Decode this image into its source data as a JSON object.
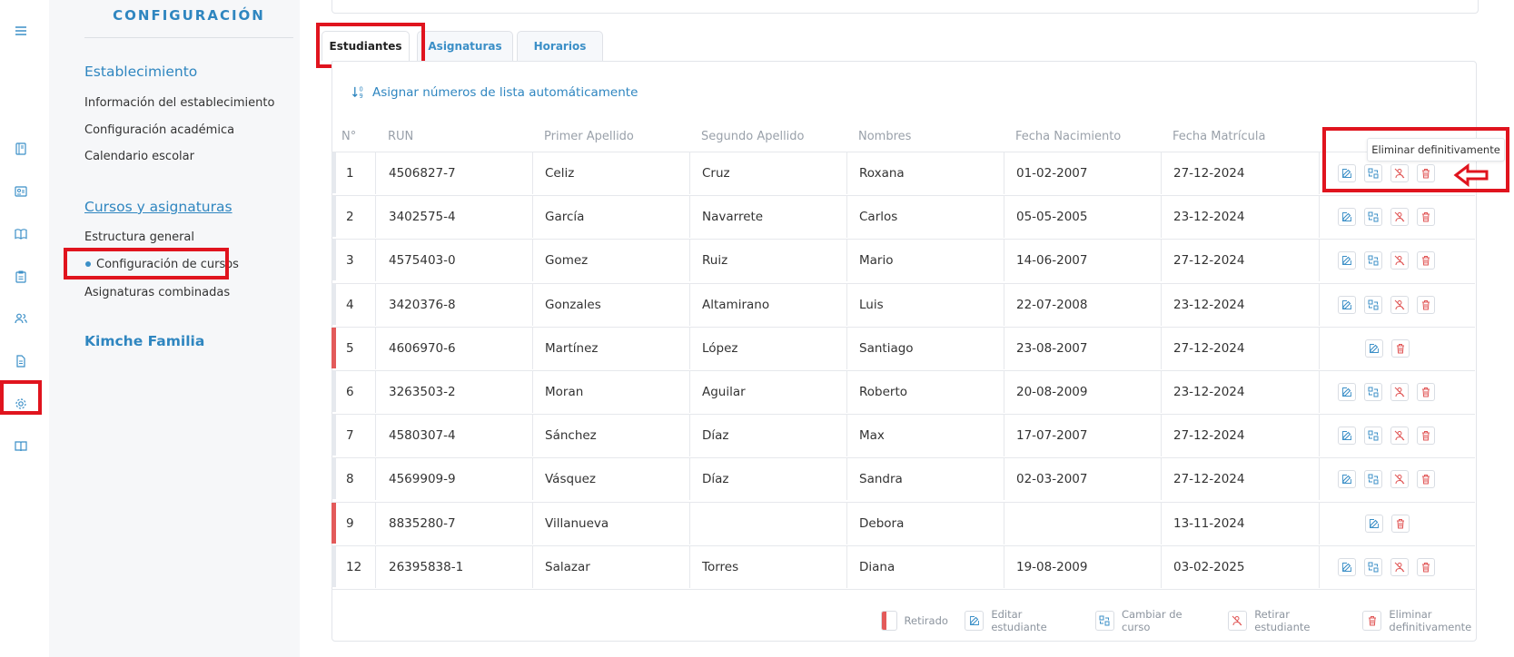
{
  "rail": {
    "icons": [
      "menu-icon",
      "book-icon",
      "id-card-icon",
      "open-book-icon",
      "clipboard-icon",
      "users-icon",
      "document-icon",
      "gear-icon",
      "book-open-icon"
    ]
  },
  "settings": {
    "title": "CONFIGURACIÓN",
    "sections": [
      {
        "heading": "Establecimiento",
        "items": [
          "Información del establecimiento",
          "Configuración académica",
          "Calendario escolar"
        ]
      },
      {
        "heading": "Cursos y asignaturas",
        "items": [
          "Estructura general",
          "Configuración de cursos",
          "Asignaturas combinadas"
        ]
      },
      {
        "heading": "Kimche Familia",
        "items": []
      }
    ]
  },
  "tabs": [
    "Estudiantes",
    "Asignaturas",
    "Horarios"
  ],
  "assign_link": "Asignar números de lista automáticamente",
  "table": {
    "headers": [
      "N°",
      "RUN",
      "Primer Apellido",
      "Segundo Apellido",
      "Nombres",
      "Fecha Nacimiento",
      "Fecha Matrícula"
    ],
    "rows": [
      {
        "n": "1",
        "run": "4506827-7",
        "ap1": "Celiz",
        "ap2": "Cruz",
        "nombres": "Roxana",
        "nac": "01-02-2007",
        "mat": "27-12-2024",
        "retired": false
      },
      {
        "n": "2",
        "run": "3402575-4",
        "ap1": "García",
        "ap2": "Navarrete",
        "nombres": "Carlos",
        "nac": "05-05-2005",
        "mat": "23-12-2024",
        "retired": false
      },
      {
        "n": "3",
        "run": "4575403-0",
        "ap1": "Gomez",
        "ap2": "Ruiz",
        "nombres": "Mario",
        "nac": "14-06-2007",
        "mat": "27-12-2024",
        "retired": false
      },
      {
        "n": "4",
        "run": "3420376-8",
        "ap1": "Gonzales",
        "ap2": "Altamirano",
        "nombres": "Luis",
        "nac": "22-07-2008",
        "mat": "23-12-2024",
        "retired": false
      },
      {
        "n": "5",
        "run": "4606970-6",
        "ap1": "Martínez",
        "ap2": "López",
        "nombres": "Santiago",
        "nac": "23-08-2007",
        "mat": "27-12-2024",
        "retired": true
      },
      {
        "n": "6",
        "run": "3263503-2",
        "ap1": "Moran",
        "ap2": "Aguilar",
        "nombres": "Roberto",
        "nac": "20-08-2009",
        "mat": "23-12-2024",
        "retired": false
      },
      {
        "n": "7",
        "run": "4580307-4",
        "ap1": "Sánchez",
        "ap2": "Díaz",
        "nombres": "Max",
        "nac": "17-07-2007",
        "mat": "27-12-2024",
        "retired": false
      },
      {
        "n": "8",
        "run": "4569909-9",
        "ap1": "Vásquez",
        "ap2": "Díaz",
        "nombres": "Sandra",
        "nac": "02-03-2007",
        "mat": "27-12-2024",
        "retired": false
      },
      {
        "n": "9",
        "run": "8835280-7",
        "ap1": "Villanueva",
        "ap2": "",
        "nombres": "Debora",
        "nac": "",
        "mat": "13-11-2024",
        "retired": true
      },
      {
        "n": "12",
        "run": "26395838-1",
        "ap1": "Salazar",
        "ap2": "Torres",
        "nombres": "Diana",
        "nac": "19-08-2009",
        "mat": "03-02-2025",
        "retired": false
      }
    ]
  },
  "tooltip": "Eliminar definitivamente",
  "legend": {
    "retired": "Retirado",
    "edit": "Editar estudiante",
    "change": "Cambiar de curso",
    "withdraw": "Retirar estudiante",
    "delete": "Eliminar definitivamente"
  },
  "colors": {
    "accent": "#2f86c0",
    "danger": "#e05555",
    "highlight": "#e0141e"
  }
}
